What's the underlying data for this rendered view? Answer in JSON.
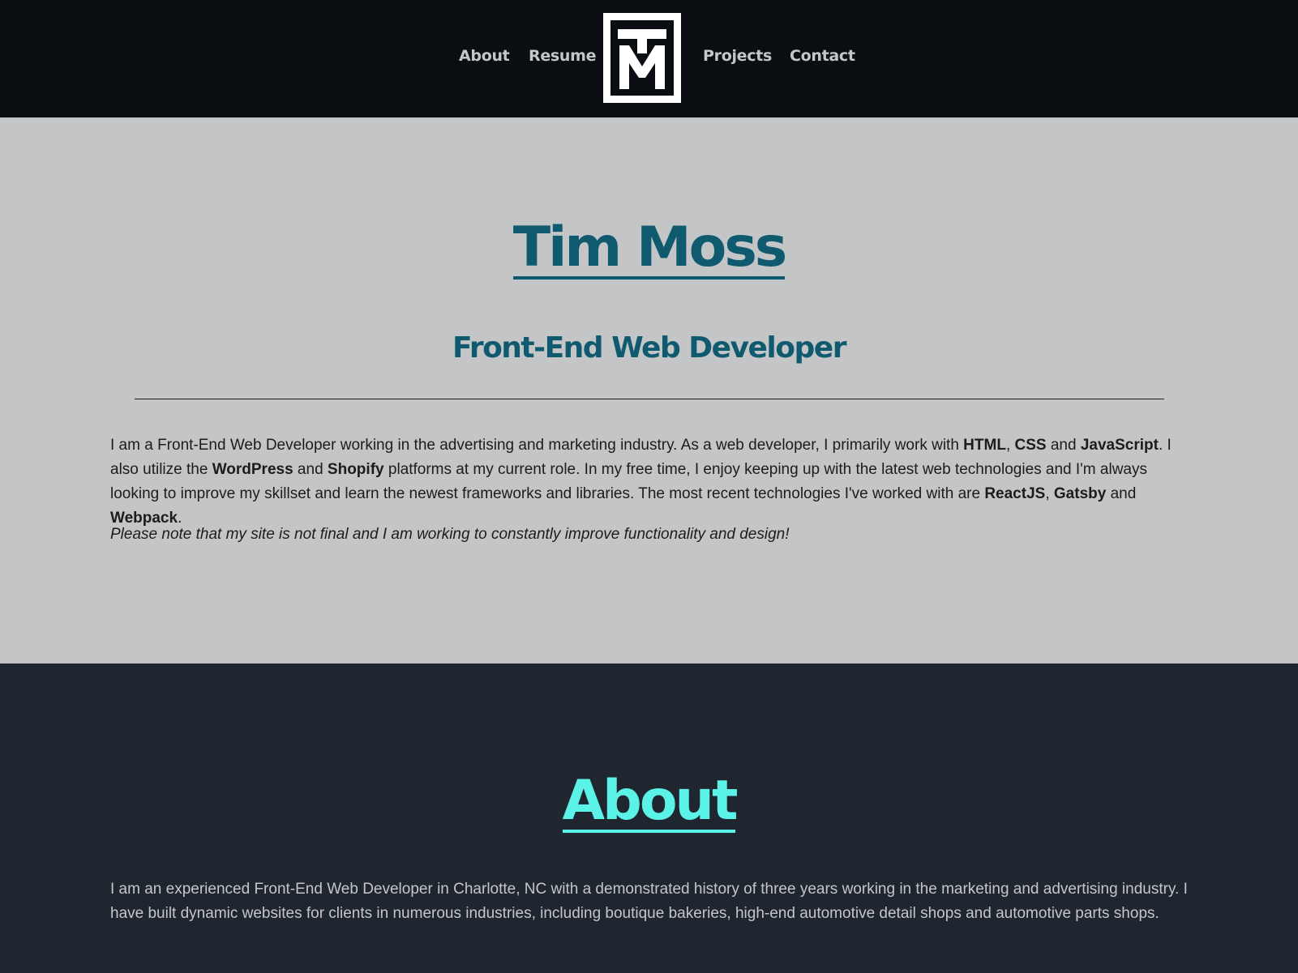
{
  "nav": {
    "items": [
      "About",
      "Resume",
      "Projects",
      "Contact"
    ],
    "logo": "TM-monogram-logo"
  },
  "hero": {
    "title": "Tim Moss",
    "subtitle": "Front-End Web Developer",
    "intro": {
      "p1": "I am a Front-End Web Developer working in the advertising and marketing industry. As a web developer, I primarily work with ",
      "html": "HTML",
      "sep1": ", ",
      "css": "CSS",
      "and1": " and ",
      "js": "JavaScript",
      "p2": ". I also utilize the ",
      "wordpress": "WordPress",
      "and2": " and ",
      "shopify": "Shopify",
      "p3": " platforms at my current role. In my free time, I enjoy keeping up with the latest web technologies and I'm always looking to improve my skillset and learn the newest frameworks and libraries. The most recent technologies I've worked with are ",
      "react": "ReactJS",
      "sep2": ", ",
      "gatsby": "Gatsby",
      "and3": " and ",
      "webpack": "Webpack",
      "end": "."
    },
    "note": "Please note that my site is not final and I am working to constantly improve functionality and design!"
  },
  "about": {
    "title": "About",
    "text": "I am an experienced Front-End Web Developer in Charlotte, NC with a demonstrated history of three years working in the marketing and advertising industry. I have built dynamic websites for clients in numerous industries, including boutique bakeries, high-end automotive detail shops and automotive parts shops."
  },
  "colors": {
    "nav_bg": "#0a0d12",
    "hero_bg": "#c4c5c7",
    "heading_teal": "#0f5a6e",
    "about_bg": "#1f2630",
    "about_accent": "#5bf3e7"
  }
}
